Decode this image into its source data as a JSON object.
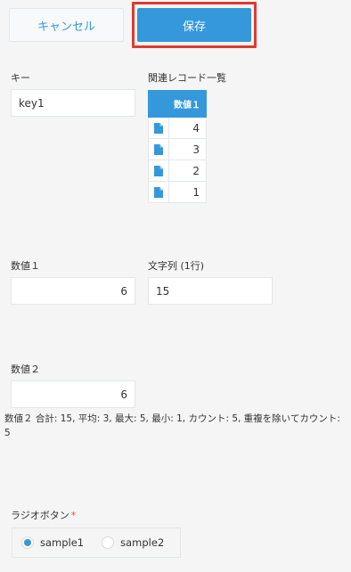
{
  "header": {
    "cancel_label": "キャンセル",
    "save_label": "保存"
  },
  "fields": {
    "key": {
      "label": "キー",
      "value": "key1"
    },
    "related": {
      "label": "関連レコード一覧",
      "column_header": "数値１",
      "rows": [
        "4",
        "3",
        "2",
        "1"
      ],
      "row_icon": "document-icon"
    },
    "num1": {
      "label": "数値１",
      "value": "6"
    },
    "text1": {
      "label": "文字列 (1行)",
      "value": "15"
    },
    "num2": {
      "label": "数値２",
      "value": "6"
    },
    "summary": "数値２ 合計: 15, 平均: 3, 最大: 5, 最小: 1, カウント: 5, 重複を除いてカウント: 5",
    "radio": {
      "label": "ラジオボタン",
      "required_mark": "*",
      "options": [
        "sample1",
        "sample2"
      ],
      "selected": "sample1"
    }
  },
  "colors": {
    "accent": "#3498db",
    "highlight_border": "#e03a2f",
    "required": "#e74c3c",
    "background": "#f5f5f5"
  }
}
